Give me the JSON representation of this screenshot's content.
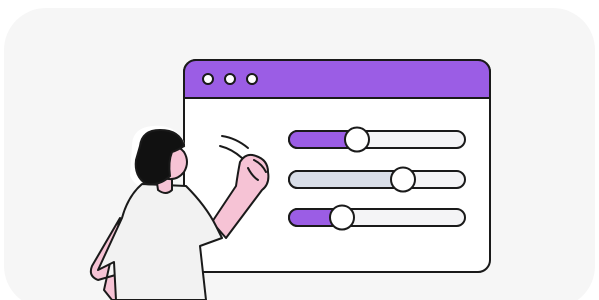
{
  "illustration": {
    "window_dots": 3,
    "sliders": [
      {
        "level": 0.4,
        "track": "purple",
        "label": "slider-1"
      },
      {
        "level": 0.64,
        "track": "gray",
        "label": "slider-2"
      },
      {
        "level": 0.31,
        "track": "purple",
        "label": "slider-3"
      }
    ],
    "character": "woman-adjusting-settings"
  },
  "colors": {
    "card_background": "#f6f6f6",
    "window_titlebar": "#9b5de5",
    "window_body": "#ffffff",
    "outline": "#1a1a1a",
    "slider_fill_purple": "#9b5de5",
    "slider_fill_gray": "#d9dee8",
    "slider_track": "#f4f4f6",
    "skin": "#f6c3d5",
    "hair": "#111111",
    "shirt": "#f2f2f2"
  }
}
